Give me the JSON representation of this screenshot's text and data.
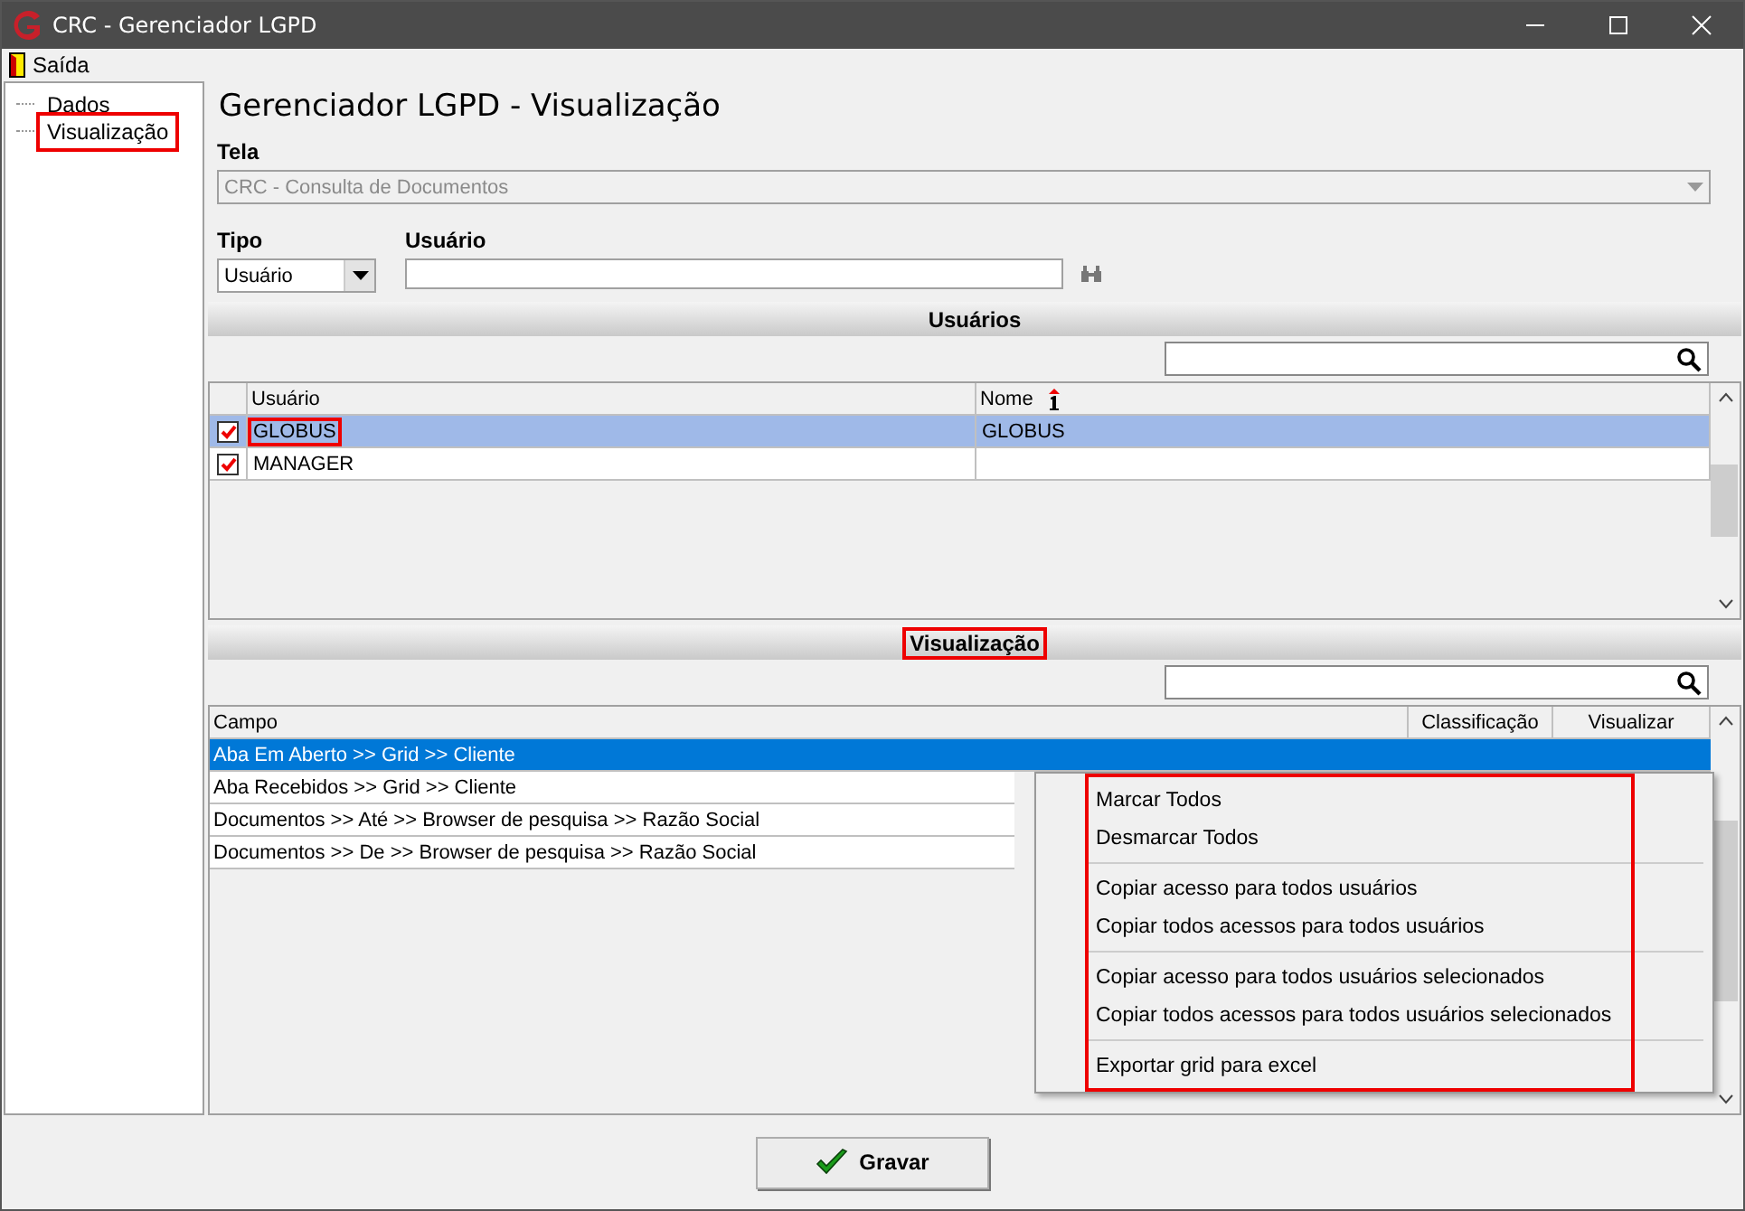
{
  "window": {
    "title": "CRC - Gerenciador LGPD"
  },
  "menu": [
    {
      "label": "Saída"
    }
  ],
  "tree": [
    {
      "label": "Dados",
      "annotated": false
    },
    {
      "label": "Visualização",
      "annotated": true
    }
  ],
  "heading": "Gerenciador LGPD - Visualização",
  "tela": {
    "label": "Tela",
    "value": "CRC - Consulta de Documentos",
    "disabled": true
  },
  "tipo": {
    "label": "Tipo",
    "value": "Usuário"
  },
  "usuario": {
    "label": "Usuário"
  },
  "users_section": {
    "title": "Usuários",
    "annotated": false,
    "columns": [
      "Usuário",
      "Nome"
    ],
    "rows": [
      {
        "checked": true,
        "selected": true,
        "cells": [
          {
            "text": "GLOBUS",
            "annotated": true
          },
          {
            "text": "GLOBUS",
            "annotated": false
          }
        ]
      },
      {
        "checked": true,
        "selected": false,
        "cells": [
          {
            "text": "MANAGER",
            "annotated": false
          }
        ]
      }
    ]
  },
  "view_section": {
    "title": "Visualização",
    "annotated": true,
    "columns": [
      "Campo",
      "Classificação",
      "Visualizar"
    ],
    "rows": [
      {
        "campo": "Aba Em Aberto >> Grid >>  Cliente",
        "selected": true
      },
      {
        "campo": "Aba Recebidos >> Grid >> Cliente",
        "selected": false
      },
      {
        "campo": "Documentos >> Até >> Browser de pesquisa >> Razão Social",
        "selected": false
      },
      {
        "campo": "Documentos >> De >> Browser de pesquisa >> Razão Social",
        "selected": false
      }
    ]
  },
  "context_menu": {
    "annotated": true,
    "groups": [
      [
        "Marcar Todos",
        "Desmarcar Todos"
      ],
      [
        "Copiar acesso para todos usuários",
        "Copiar todos acessos para todos usuários"
      ],
      [
        "Copiar acesso para todos usuários selecionados",
        "Copiar todos acessos para todos usuários selecionados"
      ],
      [
        "Exportar grid para excel"
      ]
    ]
  },
  "save_button": {
    "label": "Gravar"
  }
}
